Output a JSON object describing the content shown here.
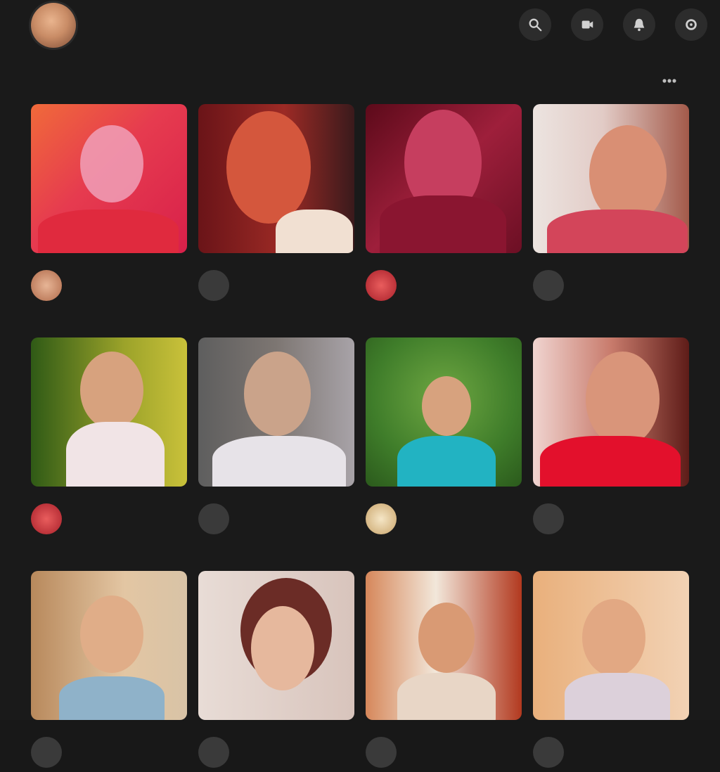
{
  "header": {
    "title": "",
    "subtitle": "",
    "actions": [
      {
        "name": "search-icon"
      },
      {
        "name": "upload-icon"
      },
      {
        "name": "notifications-icon"
      },
      {
        "name": "settings-icon"
      }
    ]
  },
  "sections": [
    {
      "title": "",
      "more": "more-icon"
    },
    {
      "title": ""
    },
    {
      "title": ""
    }
  ],
  "rows": [
    {
      "cards": [
        {
          "title": "",
          "meta": "",
          "thumb_colors": [
            "#e63b4f",
            "#f47a3a",
            "#f0a0b8"
          ],
          "avatar": "#c98c66"
        },
        {
          "title": "",
          "meta": "",
          "thumb_colors": [
            "#8c1d22",
            "#d4573d",
            "#f1e0d2"
          ],
          "avatar": "mono"
        },
        {
          "title": "",
          "meta": "",
          "thumb_colors": [
            "#7a0f22",
            "#c63e5f",
            "#e77a92"
          ],
          "avatar": "#d13b45"
        },
        {
          "title": "",
          "meta": "",
          "thumb_colors": [
            "#e9d9d4",
            "#d3455a",
            "#c47a62"
          ],
          "avatar": "mono"
        }
      ]
    },
    {
      "cards": [
        {
          "title": "",
          "meta": "",
          "thumb_colors": [
            "#3f6a1e",
            "#c9c13a",
            "#f1e4e6"
          ],
          "avatar": "#d13b45"
        },
        {
          "title": "",
          "meta": "",
          "thumb_colors": [
            "#6e6e6e",
            "#caa38a",
            "#e7e3e8"
          ],
          "avatar": "mono"
        },
        {
          "title": "",
          "meta": "",
          "thumb_colors": [
            "#3f7d2a",
            "#d7a27e",
            "#22b3c2"
          ],
          "avatar": "#e0c59a"
        },
        {
          "title": "",
          "meta": "",
          "thumb_colors": [
            "#f0d4d0",
            "#b5372f",
            "#e3102c"
          ],
          "avatar": "mono"
        }
      ]
    },
    {
      "cards": [
        {
          "title": "",
          "meta": "",
          "thumb_colors": [
            "#c69a6d",
            "#e3c6a3",
            "#8fb2c9"
          ],
          "avatar": "mono"
        },
        {
          "title": "",
          "meta": "",
          "thumb_colors": [
            "#e8dcd6",
            "#6b2c26",
            "#e6b89d"
          ],
          "avatar": "mono"
        },
        {
          "title": "",
          "meta": "",
          "thumb_colors": [
            "#d6875a",
            "#f2e7da",
            "#b2391f"
          ],
          "avatar": "mono"
        },
        {
          "title": "",
          "meta": "",
          "thumb_colors": [
            "#e9b07c",
            "#f2d2b4",
            "#dcd0da"
          ],
          "avatar": "mono"
        }
      ]
    }
  ],
  "colors": {
    "background": "#1a1a1a",
    "card_bg": "#222222",
    "muted": "#7f7f7f"
  }
}
